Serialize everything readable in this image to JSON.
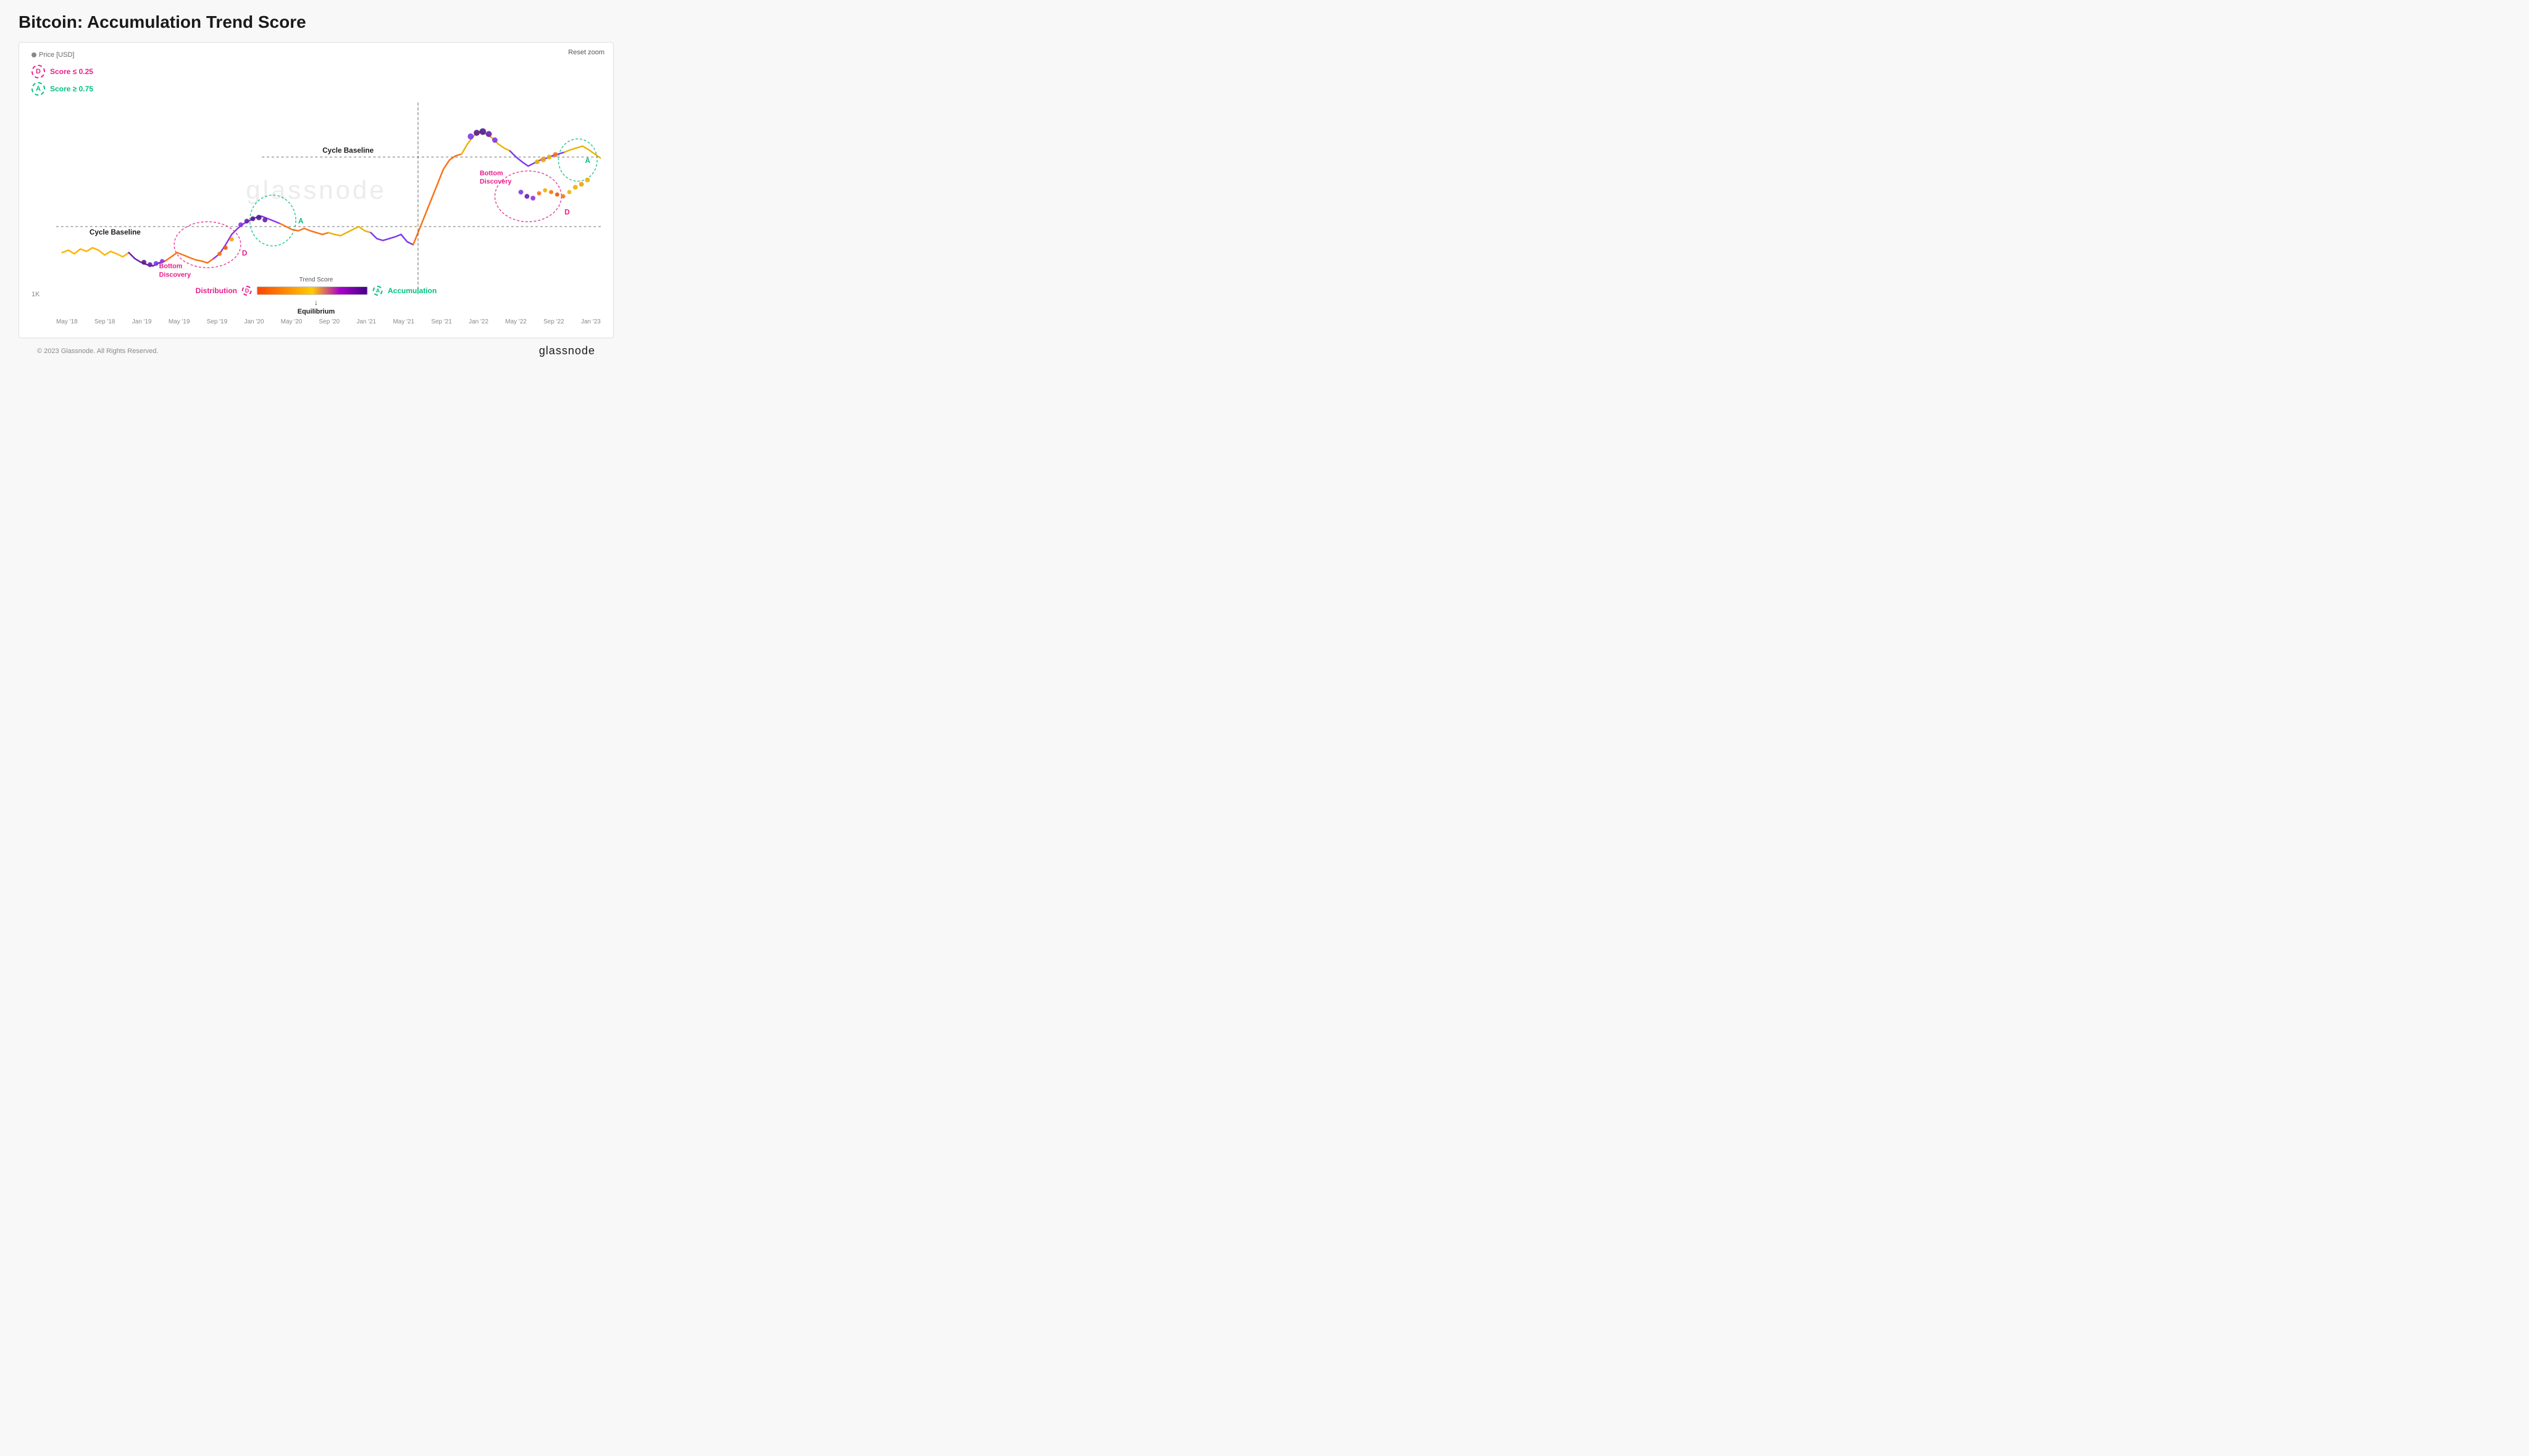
{
  "page": {
    "title": "Bitcoin: Accumulation Trend Score",
    "footer_copyright": "© 2023 Glassnode. All Rights Reserved.",
    "footer_logo": "glassnode"
  },
  "chart": {
    "price_label": "Price [USD]",
    "reset_zoom": "Reset zoom",
    "y_axis_min": "1K",
    "watermark": "glassnode",
    "cycle_baseline_1": "Cycle Baseline",
    "cycle_baseline_2": "Cycle Baseline",
    "bottom_discovery_1": "Bottom\nDiscovery",
    "bottom_discovery_2": "Bottom\nDiscovery",
    "label_d_1": "D",
    "label_a_1": "A",
    "label_d_2": "D",
    "label_a_2": "A"
  },
  "legend": {
    "d_label": "D",
    "d_score": "Score ≤ 0.25",
    "a_label": "A",
    "a_score": "Score ≥ 0.75"
  },
  "trend_score": {
    "title": "Trend Score",
    "distribution": "Distribution",
    "accumulation": "Accumulation",
    "equilibrium": "Equilibrium",
    "d_symbol": "D",
    "a_symbol": "A"
  },
  "x_axis": {
    "labels": [
      "May '18",
      "Sep '18",
      "Jan '19",
      "May '19",
      "Sep '19",
      "Jan '20",
      "May '20",
      "Sep '20",
      "Jan '21",
      "May '21",
      "Sep '21",
      "Jan '22",
      "May '22",
      "Sep '22",
      "Jan '23"
    ]
  }
}
